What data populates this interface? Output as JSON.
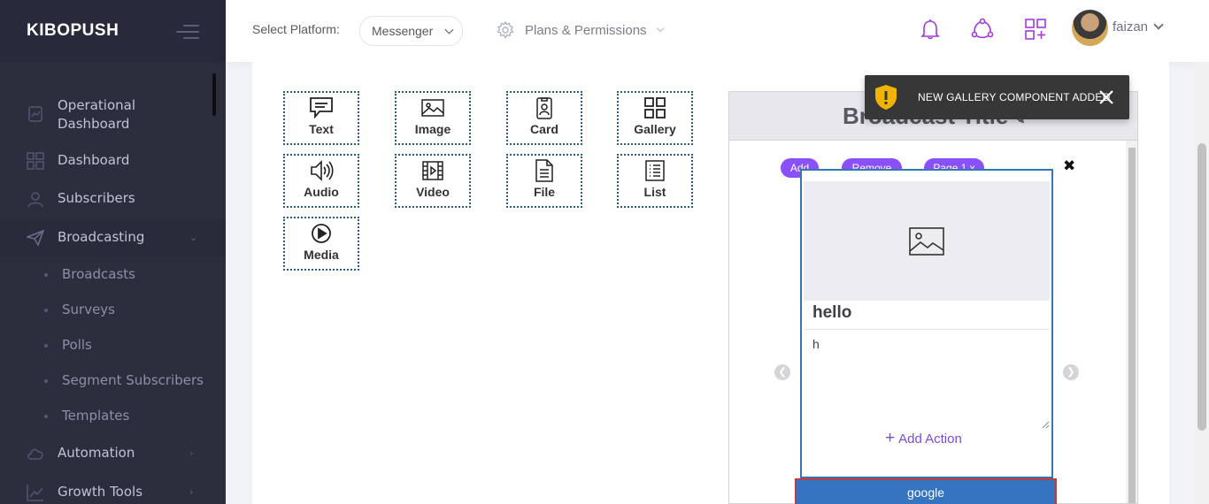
{
  "app": {
    "brand": "KIBOPUSH"
  },
  "sidebar": {
    "items": [
      {
        "label": "Operational Dashboard",
        "icon": "dashboard-chart-icon"
      },
      {
        "label": "Dashboard",
        "icon": "grid-icon"
      },
      {
        "label": "Subscribers",
        "icon": "user-icon"
      },
      {
        "label": "Broadcasting",
        "icon": "paper-plane-icon",
        "expanded": true
      },
      {
        "label": "Automation",
        "icon": "cloud-icon"
      },
      {
        "label": "Growth Tools",
        "icon": "growth-chart-icon"
      }
    ],
    "sub_items": [
      "Broadcasts",
      "Surveys",
      "Polls",
      "Segment Subscribers",
      "Templates"
    ]
  },
  "topbar": {
    "platform_label": "Select Platform:",
    "platform_value": "Messenger",
    "plans_label": "Plans & Permissions",
    "username": "faizan"
  },
  "components": [
    {
      "label": "Text",
      "icon": "text-icon"
    },
    {
      "label": "Image",
      "icon": "image-icon"
    },
    {
      "label": "Card",
      "icon": "card-icon"
    },
    {
      "label": "Gallery",
      "icon": "gallery-icon"
    },
    {
      "label": "Audio",
      "icon": "audio-icon"
    },
    {
      "label": "Video",
      "icon": "video-icon"
    },
    {
      "label": "File",
      "icon": "file-icon"
    },
    {
      "label": "List",
      "icon": "list-icon"
    },
    {
      "label": "Media",
      "icon": "media-icon"
    }
  ],
  "preview": {
    "title": "Broadcast Title",
    "add_pill": "Add",
    "remove_pill": "Remove",
    "page_pill": "Page 1 x",
    "gallery_title": "hello",
    "gallery_subtitle": "h",
    "add_action": "Add Action",
    "button_label": "google"
  },
  "toast": {
    "message": "NEW GALLERY COMPONENT ADDED"
  },
  "colors": {
    "accent": "#8950fc",
    "sidebar_bg": "#2c2e3e",
    "toast_bg": "#373737",
    "button_blue": "#3474c0"
  }
}
